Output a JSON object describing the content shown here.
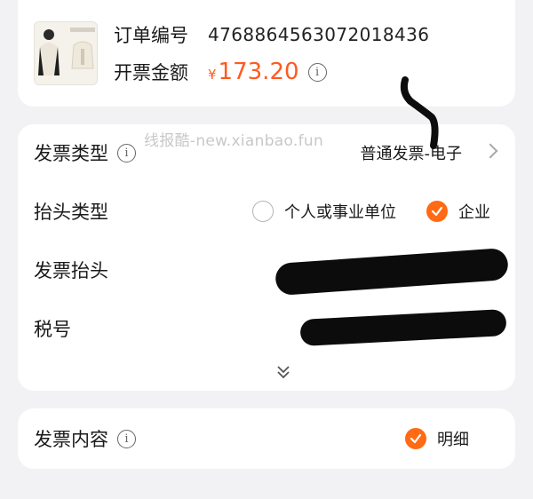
{
  "order": {
    "order_no_label": "订单编号",
    "order_no": "4768864563072018436",
    "amount_label": "开票金额",
    "currency": "¥",
    "amount": "173.20"
  },
  "watermark": "线报酷-new.xianbao.fun",
  "invoice": {
    "type_label": "发票类型",
    "type_value": "普通发票-电子",
    "header_type_label": "抬头类型",
    "header_type_options": [
      "个人或事业单位",
      "企业"
    ],
    "header_type_selected": "企业",
    "header_label": "发票抬头",
    "tax_no_label": "税号"
  },
  "content": {
    "label": "发票内容",
    "option": "明细"
  },
  "colors": {
    "accent": "#ff6a13",
    "price": "#ff5a1f",
    "background": "#f2f2f4"
  }
}
